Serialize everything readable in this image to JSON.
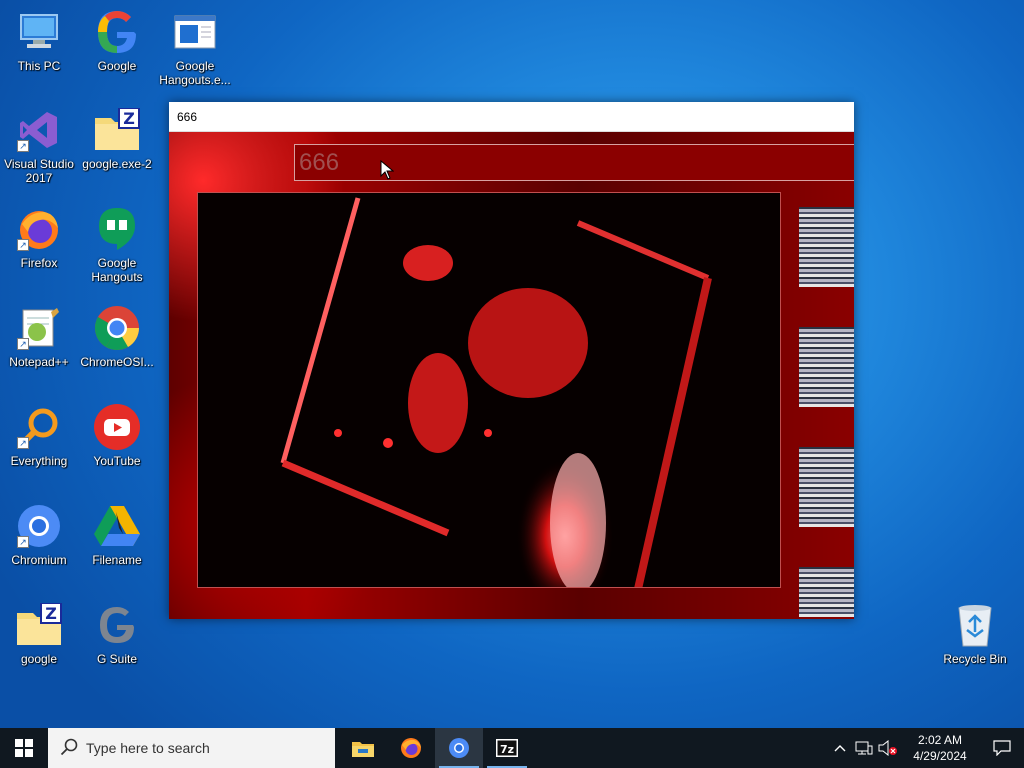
{
  "desktop": {
    "icons": [
      {
        "label": "This PC",
        "icon": "computer-icon"
      },
      {
        "label": "Google",
        "icon": "google-logo-icon"
      },
      {
        "label": "Google Hangouts.e...",
        "icon": "app-window-icon"
      },
      {
        "label": "Visual Studio 2017",
        "icon": "visual-studio-icon"
      },
      {
        "label": "google.exe-2",
        "icon": "zip-folder-icon"
      },
      {
        "label": "Firefox",
        "icon": "firefox-icon"
      },
      {
        "label": "Google Hangouts",
        "icon": "hangouts-icon"
      },
      {
        "label": "Notepad++",
        "icon": "notepad-plus-icon"
      },
      {
        "label": "ChromeOSI...",
        "icon": "chrome-icon"
      },
      {
        "label": "Everything",
        "icon": "magnifier-icon"
      },
      {
        "label": "YouTube",
        "icon": "youtube-icon"
      },
      {
        "label": "Chromium",
        "icon": "chromium-icon"
      },
      {
        "label": "Filename",
        "icon": "drive-icon"
      },
      {
        "label": "google",
        "icon": "zip-folder-icon"
      },
      {
        "label": "G Suite",
        "icon": "gsuite-icon"
      },
      {
        "label": "Recycle Bin",
        "icon": "recycle-bin-icon"
      }
    ]
  },
  "window": {
    "title": "666",
    "search_value": "666"
  },
  "taskbar": {
    "search_placeholder": "Type here to search",
    "apps": [
      "file-explorer-icon",
      "firefox-icon",
      "chromium-icon",
      "7zip-icon"
    ],
    "time": "2:02 AM",
    "date": "4/29/2024"
  },
  "colors": {
    "desktop_blue": "#1f86dc",
    "taskbar": "#101820",
    "window_red": "#8b0000"
  }
}
